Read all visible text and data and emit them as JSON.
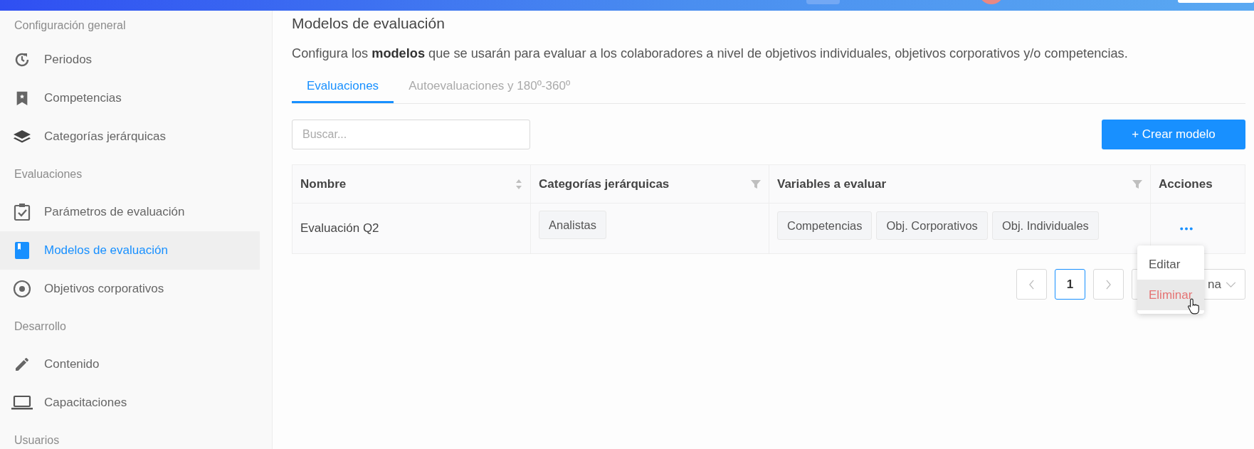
{
  "sidebar": {
    "sections": [
      {
        "title": "Configuración general",
        "items": [
          {
            "label": "Periodos",
            "selected": false
          },
          {
            "label": "Competencias",
            "selected": false
          },
          {
            "label": "Categorías jerárquicas",
            "selected": false
          }
        ]
      },
      {
        "title": "Evaluaciones",
        "items": [
          {
            "label": "Parámetros de evaluación",
            "selected": false
          },
          {
            "label": "Modelos de evaluación",
            "selected": true
          },
          {
            "label": "Objetivos corporativos",
            "selected": false
          }
        ]
      },
      {
        "title": "Desarrollo",
        "items": [
          {
            "label": "Contenido",
            "selected": false
          },
          {
            "label": "Capacitaciones",
            "selected": false
          }
        ]
      },
      {
        "title": "Usuarios"
      }
    ]
  },
  "page": {
    "title": "Modelos de evaluación",
    "description": "Configura los **modelos** que se usarán para evaluar a los colaboradores a nivel de objetivos individuales, objetivos corporativos y/o competencias."
  },
  "tabs": [
    {
      "label": "Evaluaciones",
      "selected": true
    },
    {
      "label": "Autoevaluaciones y 180º-360º",
      "selected": false
    }
  ],
  "search": {
    "placeholder": "Buscar..."
  },
  "create_button": "+ Crear modelo",
  "table": {
    "columns": [
      {
        "label": "Nombre",
        "kind": "sortable"
      },
      {
        "label": "Categorías jerárquicas",
        "kind": "filterable"
      },
      {
        "label": "Variables a evaluar",
        "kind": "filterable"
      },
      {
        "label": "Acciones",
        "kind": "plain"
      }
    ],
    "rows": [
      {
        "name": "Evaluación Q2",
        "categories": [
          "Analistas"
        ],
        "variables": [
          "Competencias",
          "Obj. Corporativos",
          "Obj. Individuales"
        ]
      }
    ]
  },
  "pagination": {
    "pages": [
      {
        "label": "1",
        "selected": true
      }
    ],
    "page_size_visible": "na"
  },
  "action_menu": {
    "items": [
      {
        "label": "Editar",
        "kind": "normal",
        "hovered": false
      },
      {
        "label": "Eliminar",
        "kind": "danger",
        "hovered": true
      }
    ]
  }
}
